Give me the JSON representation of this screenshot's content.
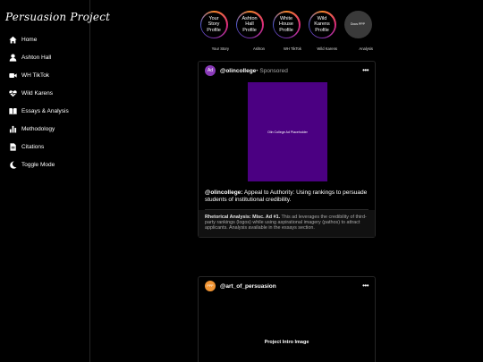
{
  "app": {
    "logo": "Persuasion Project"
  },
  "nav": [
    {
      "label": "Home",
      "icon": "home-icon"
    },
    {
      "label": "Ashton Hall",
      "icon": "user-icon"
    },
    {
      "label": "WH TikTok",
      "icon": "video-icon"
    },
    {
      "label": "Wild Karens",
      "icon": "heart-pulse-icon"
    },
    {
      "label": "Essays & Analysis",
      "icon": "book-icon"
    },
    {
      "label": "Methodology",
      "icon": "bar-chart-icon"
    },
    {
      "label": "Citations",
      "icon": "document-icon"
    },
    {
      "label": "Toggle Mode",
      "icon": "moon-icon"
    }
  ],
  "stories": [
    {
      "ring_text": "Your Story Profile",
      "caption": "Your Story"
    },
    {
      "ring_text": "Ashton Hall Profile",
      "caption": "Ashton"
    },
    {
      "ring_text": "White House Profile",
      "caption": "WH TikTok"
    },
    {
      "ring_text": "Wild Karens Profile",
      "caption": "Wild Karens"
    },
    {
      "ring_text": "Docs PPP",
      "caption": "Analysis"
    }
  ],
  "post1": {
    "avatar": "Ad",
    "avatar_color": "#8a3ab9",
    "handle": "@olincollege",
    "sponsored": " • Sponsored",
    "more": "•••",
    "media_label": "Olin College Ad Placeholder",
    "media_color": "#4b0082",
    "caption_handle": "@olincollege:",
    "caption_text": " Appeal to Authority: Using rankings to persuade students of institutional credibility.",
    "analysis_title": "Rhetorical Analysis: Misc. Ad #1.",
    "analysis_text": " This ad leverages the credibility of third-party rankings (logos) while using aspirational imagery (pathos) to attract applicants. Analysis available in the essays section."
  },
  "post2": {
    "avatar": "PPP",
    "avatar_color": "#f09433",
    "handle": "@art_of_persuasion",
    "more": "•••",
    "media_label": "Project Intro Image"
  }
}
